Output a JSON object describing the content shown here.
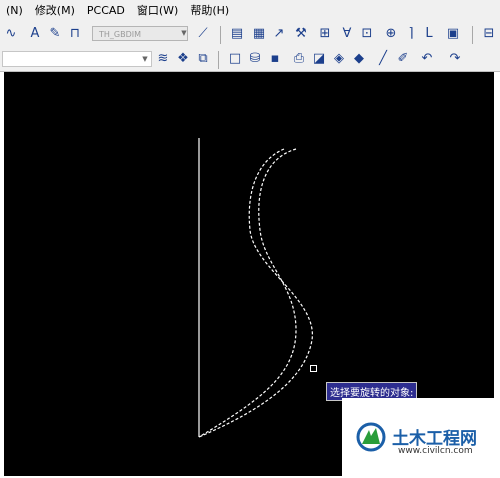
{
  "menu": [
    "(N)",
    "修改(M)",
    "PCCAD",
    "窗口(W)",
    "帮助(H)"
  ],
  "toolbar": {
    "style_combo_value": "TH_GBDIM"
  },
  "canvas": {
    "background": "#000000",
    "prompt": "选择要旋转的对象:"
  },
  "watermark": {
    "title": "土木工程网",
    "url": "www.civilcn.com"
  }
}
